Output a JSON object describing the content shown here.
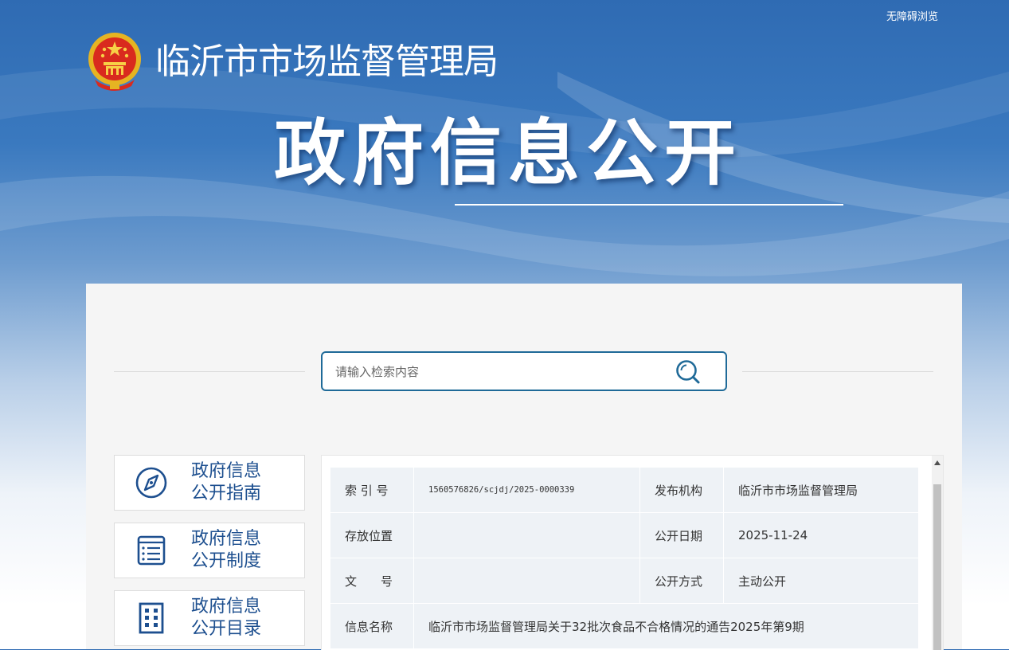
{
  "header": {
    "accessibility_link": "无障碍浏览",
    "site_title": "临沂市市场监督管理局",
    "hero_title": "政府信息公开"
  },
  "search": {
    "placeholder": "请输入检索内容"
  },
  "sidebar": {
    "cards": [
      {
        "line1": "政府信息",
        "line2": "公开指南",
        "icon": "compass-icon"
      },
      {
        "line1": "政府信息",
        "line2": "公开制度",
        "icon": "list-document-icon"
      },
      {
        "line1": "政府信息",
        "line2": "公开目录",
        "icon": "building-icon"
      }
    ]
  },
  "info": {
    "rows": [
      {
        "label1": "索 引 号",
        "value1": "1560576826/scjdj/2025-0000339",
        "label2": "发布机构",
        "value2": "临沂市市场监督管理局"
      },
      {
        "label1": "存放位置",
        "value1": "",
        "label2": "公开日期",
        "value2": "2025-11-24"
      },
      {
        "label1": "文　　号",
        "value1": "",
        "label2": "公开方式",
        "value2": "主动公开"
      }
    ],
    "title_label": "信息名称",
    "title_value": "临沂市市场监督管理局关于32批次食品不合格情况的通告2025年第9期"
  },
  "colors": {
    "header_blue": "#2f6bb3",
    "accent_teal": "#1f6a98",
    "card_text": "#1d4f8f",
    "table_bg": "#eef2f6"
  }
}
